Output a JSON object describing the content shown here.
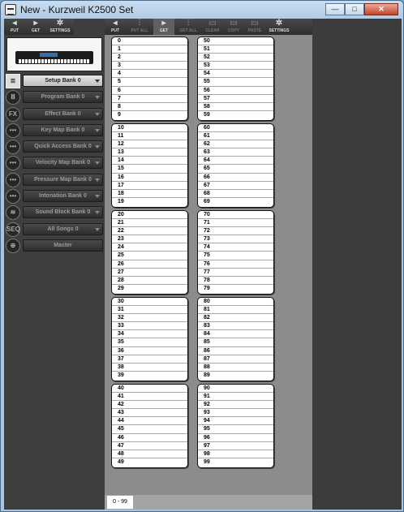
{
  "window": {
    "title": "New - Kurzweil K2500 Set",
    "minimize": "—",
    "maximize": "□",
    "close": "✕"
  },
  "left_toolbar": [
    {
      "label": "PUT",
      "icon": "◂"
    },
    {
      "label": "GET",
      "icon": "▸"
    },
    {
      "label": "SETTINGS",
      "icon": "✲"
    }
  ],
  "center_toolbar": [
    {
      "label": "PUT",
      "icon": "◂",
      "state": "normal"
    },
    {
      "label": "PUT ALL",
      "icon": "⫶",
      "state": "dim"
    },
    {
      "label": "GET",
      "icon": "▸",
      "state": "active"
    },
    {
      "label": "GET ALL",
      "icon": "⫶",
      "state": "dim"
    },
    {
      "label": "CLEAR",
      "icon": "▭",
      "state": "dim"
    },
    {
      "label": "COPY",
      "icon": "▭",
      "state": "dim"
    },
    {
      "label": "PASTE",
      "icon": "▭",
      "state": "dim"
    },
    {
      "label": "SETTINGS",
      "icon": "✲",
      "state": "normal"
    }
  ],
  "banks": [
    {
      "label": "Setup Bank 0",
      "icon": "≣",
      "selected": true
    },
    {
      "label": "Program Bank 0",
      "icon": "Ⅲ",
      "selected": false
    },
    {
      "label": "Effect Bank 0",
      "icon": "FX",
      "selected": false
    },
    {
      "label": "Key Map Bank 0",
      "icon": "•••",
      "selected": false
    },
    {
      "label": "Quick Access Bank 0",
      "icon": "•••",
      "selected": false
    },
    {
      "label": "Velocity Map Bank 0",
      "icon": "•••",
      "selected": false
    },
    {
      "label": "Pressure Map Bank 0",
      "icon": "•••",
      "selected": false
    },
    {
      "label": "Intonation Bank 0",
      "icon": "•••",
      "selected": false
    },
    {
      "label": "Sound Block Bank 0",
      "icon": "≋",
      "selected": false
    },
    {
      "label": "All Songs 0",
      "icon": "SEQ",
      "selected": false
    },
    {
      "label": "Master",
      "icon": "⊕",
      "selected": false
    }
  ],
  "slots_first": 0,
  "slots_last": 99,
  "status_tab": "0 - 99"
}
